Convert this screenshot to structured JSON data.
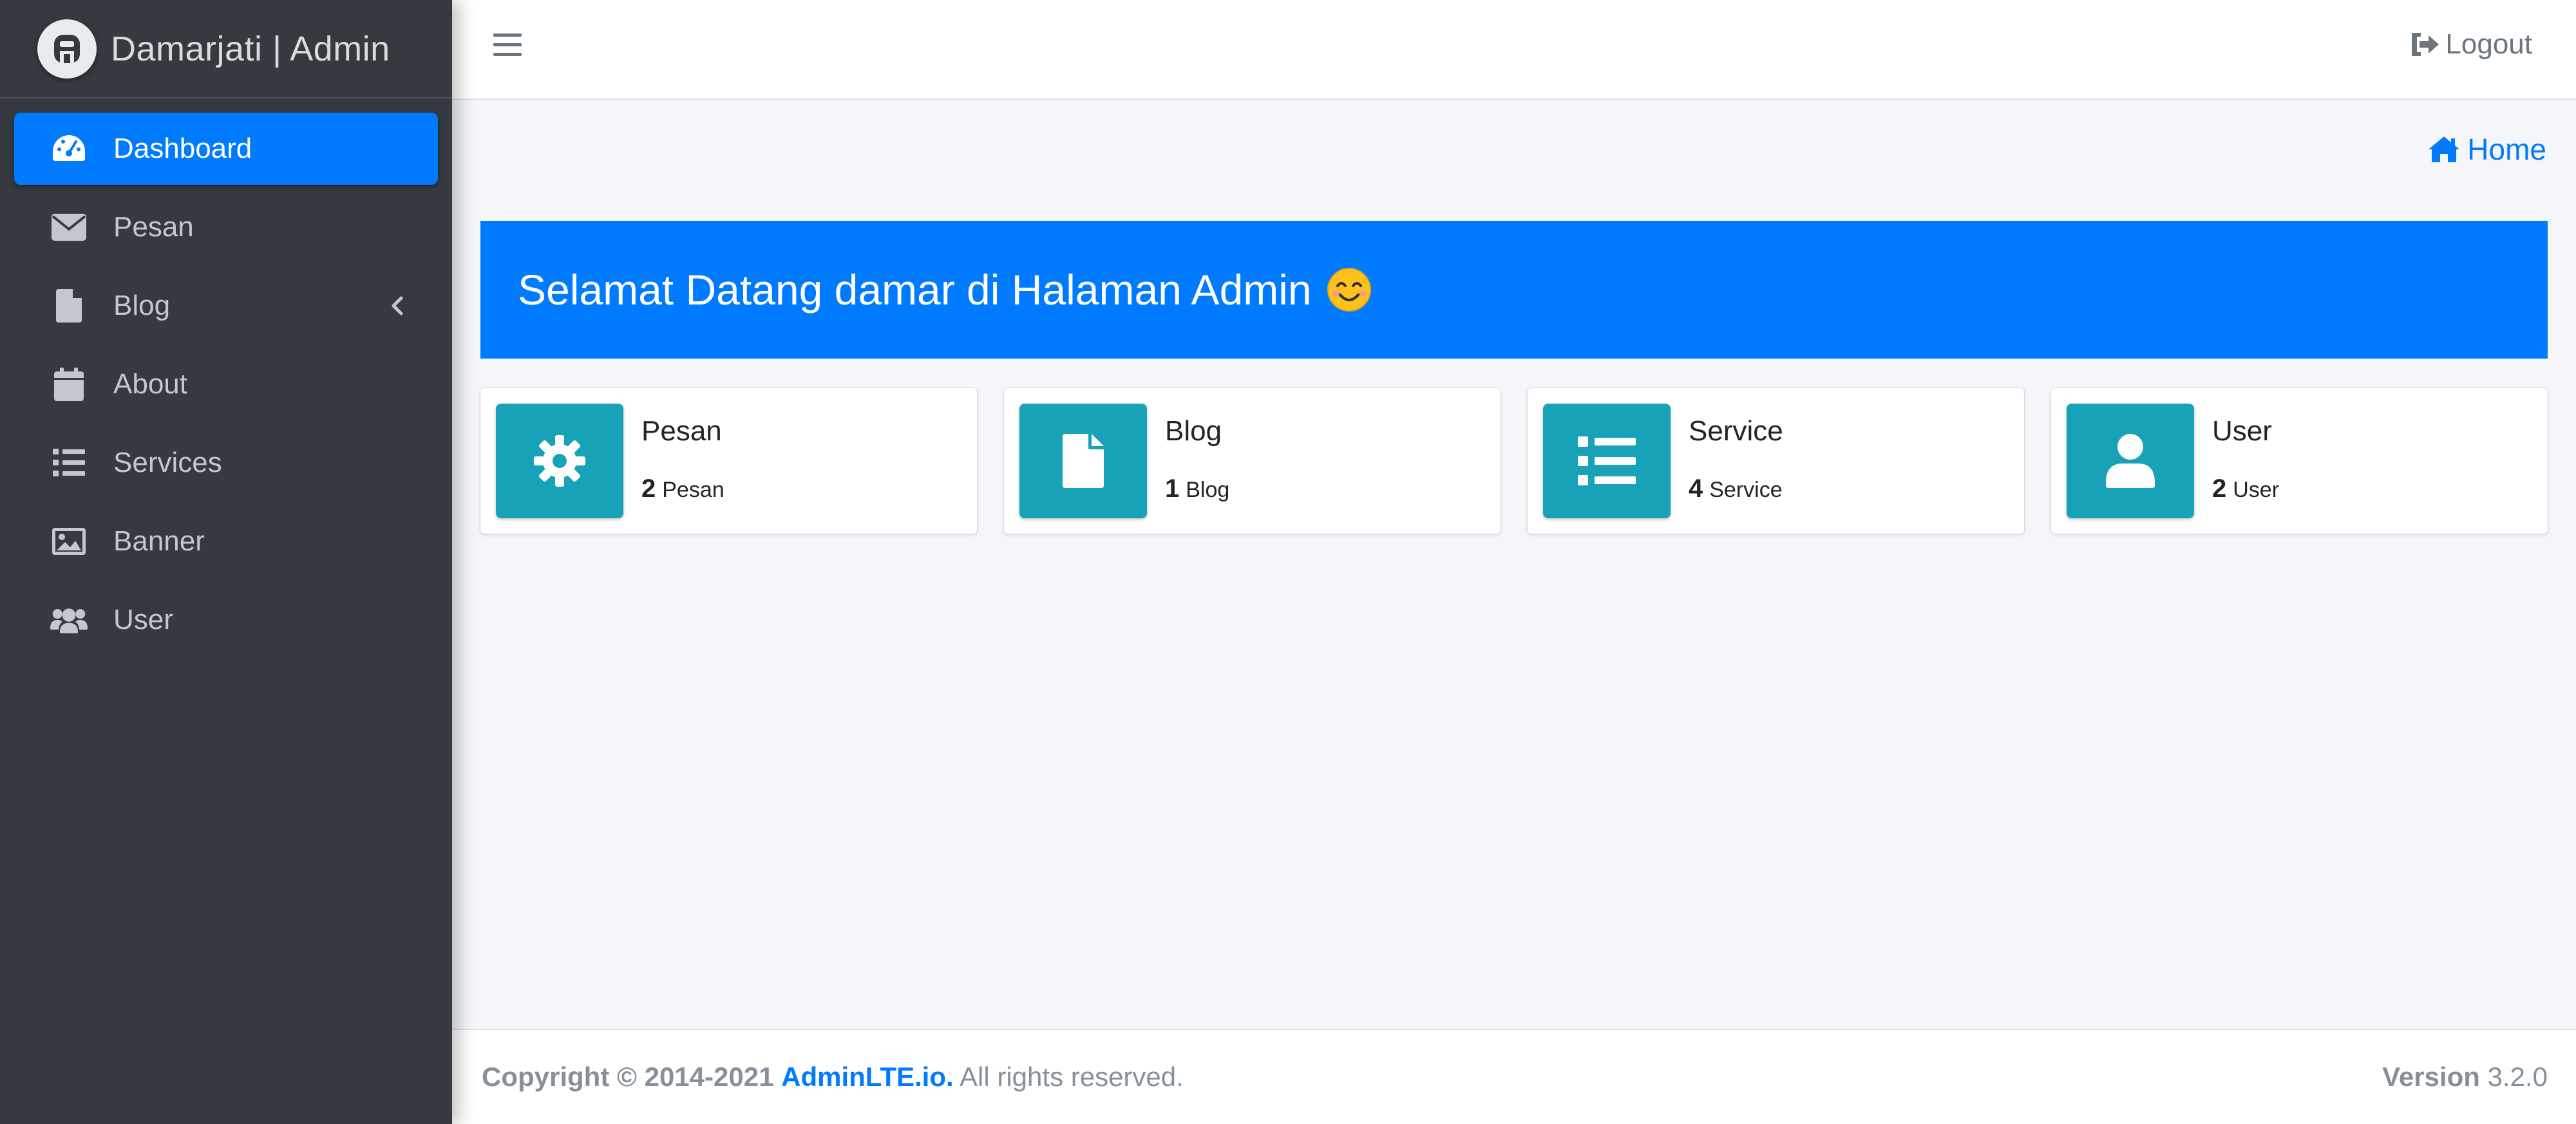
{
  "sidebar": {
    "brand": "Damarjati | Admin",
    "items": [
      {
        "label": "Dashboard",
        "icon": "tachometer-icon",
        "active": true
      },
      {
        "label": "Pesan",
        "icon": "envelope-icon"
      },
      {
        "label": "Blog",
        "icon": "file-icon"
      },
      {
        "label": "About",
        "icon": "calendar-icon"
      },
      {
        "label": "Services",
        "icon": "list-icon"
      },
      {
        "label": "Banner",
        "icon": "image-icon"
      },
      {
        "label": "User",
        "icon": "users-icon"
      }
    ]
  },
  "topbar": {
    "logout_label": "Logout"
  },
  "breadcrumb": {
    "home_label": "Home"
  },
  "welcome": {
    "text": "Selamat Datang damar di Halaman Admin"
  },
  "cards": [
    {
      "title": "Pesan",
      "count": "2",
      "unit": "Pesan",
      "icon": "gear-icon"
    },
    {
      "title": "Blog",
      "count": "1",
      "unit": "Blog",
      "icon": "file-icon"
    },
    {
      "title": "Service",
      "count": "4",
      "unit": "Service",
      "icon": "list-icon"
    },
    {
      "title": "User",
      "count": "2",
      "unit": "User",
      "icon": "user-icon"
    }
  ],
  "footer": {
    "copyright": "Copyright © 2014-2021",
    "link": "AdminLTE.io.",
    "rights": "All rights reserved.",
    "version_label": "Version",
    "version_value": "3.2.0"
  },
  "colors": {
    "sidebar_bg": "#343a40",
    "primary": "#007bff",
    "info": "#17a2b8",
    "content_bg": "#f4f6f9"
  }
}
